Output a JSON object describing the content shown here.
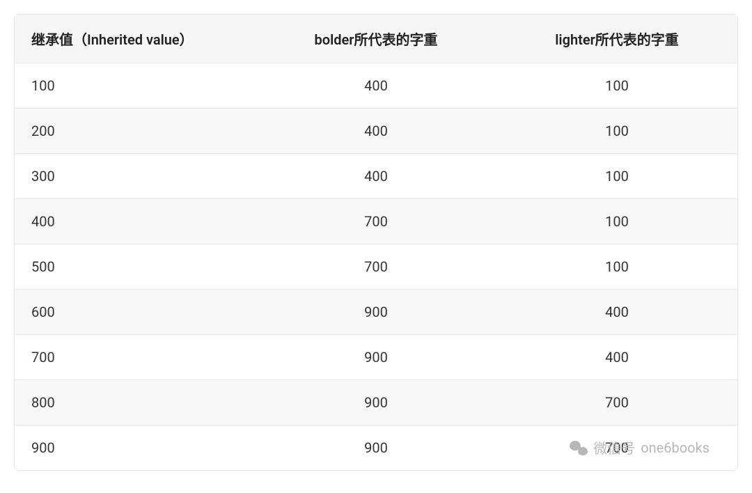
{
  "chart_data": {
    "type": "table",
    "columns": [
      "继承值（Inherited value）",
      "bolder所代表的字重",
      "lighter所代表的字重"
    ],
    "rows": [
      [
        "100",
        "400",
        "100"
      ],
      [
        "200",
        "400",
        "100"
      ],
      [
        "300",
        "400",
        "100"
      ],
      [
        "400",
        "700",
        "100"
      ],
      [
        "500",
        "700",
        "100"
      ],
      [
        "600",
        "900",
        "400"
      ],
      [
        "700",
        "900",
        "400"
      ],
      [
        "800",
        "900",
        "700"
      ],
      [
        "900",
        "900",
        "700"
      ]
    ]
  },
  "headers": {
    "col1": "继承值（Inherited value）",
    "col2": "bolder所代表的字重",
    "col3": "lighter所代表的字重"
  },
  "rows": [
    {
      "c1": "100",
      "c2": "400",
      "c3": "100"
    },
    {
      "c1": "200",
      "c2": "400",
      "c3": "100"
    },
    {
      "c1": "300",
      "c2": "400",
      "c3": "100"
    },
    {
      "c1": "400",
      "c2": "700",
      "c3": "100"
    },
    {
      "c1": "500",
      "c2": "700",
      "c3": "100"
    },
    {
      "c1": "600",
      "c2": "900",
      "c3": "400"
    },
    {
      "c1": "700",
      "c2": "900",
      "c3": "400"
    },
    {
      "c1": "800",
      "c2": "900",
      "c3": "700"
    },
    {
      "c1": "900",
      "c2": "900",
      "c3": "700"
    }
  ],
  "watermark": {
    "label_prefix": "微信号",
    "account": "one6books"
  }
}
